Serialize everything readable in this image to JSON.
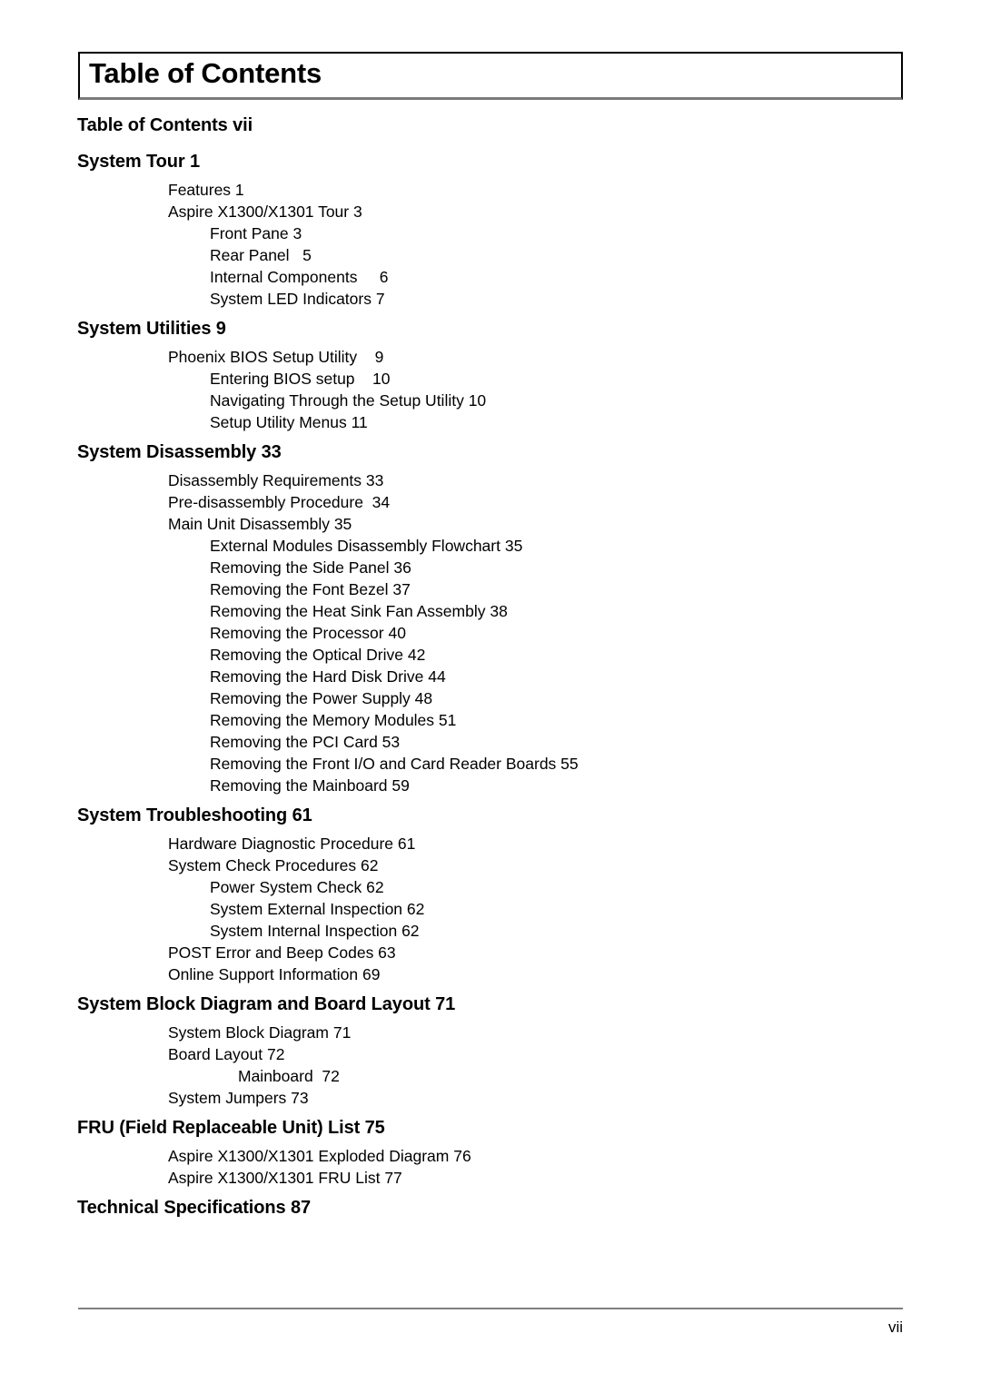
{
  "document": {
    "title": "Table of Contents",
    "page_number": "vii"
  },
  "toc": {
    "entries": [
      {
        "level": "h",
        "text": "Table of Contents vii"
      },
      {
        "level": "h",
        "text": "System Tour 1"
      },
      {
        "level": "1",
        "text": "Features 1"
      },
      {
        "level": "1",
        "text": "Aspire X1300/X1301 Tour 3"
      },
      {
        "level": "2",
        "text": "Front Pane 3"
      },
      {
        "level": "2",
        "text": "Rear Panel   5"
      },
      {
        "level": "2",
        "text": "Internal Components     6"
      },
      {
        "level": "2",
        "text": "System LED Indicators 7"
      },
      {
        "level": "h",
        "text": "System Utilities 9"
      },
      {
        "level": "1",
        "text": "Phoenix BIOS Setup Utility    9"
      },
      {
        "level": "2",
        "text": "Entering BIOS setup    10"
      },
      {
        "level": "2",
        "text": "Navigating Through the Setup Utility 10"
      },
      {
        "level": "2",
        "text": "Setup Utility Menus 11"
      },
      {
        "level": "h",
        "text": "System Disassembly 33"
      },
      {
        "level": "1",
        "text": "Disassembly Requirements 33"
      },
      {
        "level": "1",
        "text": "Pre-disassembly Procedure  34"
      },
      {
        "level": "1",
        "text": "Main Unit Disassembly 35"
      },
      {
        "level": "2",
        "text": "External Modules Disassembly Flowchart 35"
      },
      {
        "level": "2",
        "text": "Removing the Side Panel 36"
      },
      {
        "level": "2",
        "text": "Removing the Font Bezel 37"
      },
      {
        "level": "2",
        "text": "Removing the Heat Sink Fan Assembly 38"
      },
      {
        "level": "2",
        "text": "Removing the Processor 40"
      },
      {
        "level": "2",
        "text": "Removing the Optical Drive 42"
      },
      {
        "level": "2",
        "text": "Removing the Hard Disk Drive 44"
      },
      {
        "level": "2",
        "text": "Removing the Power Supply 48"
      },
      {
        "level": "2",
        "text": "Removing the Memory Modules 51"
      },
      {
        "level": "2",
        "text": "Removing the PCI Card 53"
      },
      {
        "level": "2",
        "text": "Removing the Front I/O and Card Reader Boards 55"
      },
      {
        "level": "2",
        "text": "Removing the Mainboard 59"
      },
      {
        "level": "h",
        "text": "System Troubleshooting 61"
      },
      {
        "level": "1",
        "text": "Hardware Diagnostic Procedure 61"
      },
      {
        "level": "1",
        "text": "System Check Procedures 62"
      },
      {
        "level": "2",
        "text": "Power System Check 62"
      },
      {
        "level": "2",
        "text": "System External Inspection 62"
      },
      {
        "level": "2",
        "text": "System Internal Inspection 62"
      },
      {
        "level": "1",
        "text": "POST Error and Beep Codes 63"
      },
      {
        "level": "1",
        "text": "Online Support Information 69"
      },
      {
        "level": "h",
        "text": "System Block Diagram and Board Layout 71"
      },
      {
        "level": "1",
        "text": "System Block Diagram 71"
      },
      {
        "level": "1",
        "text": "Board Layout 72"
      },
      {
        "level": "3",
        "text": "Mainboard  72"
      },
      {
        "level": "1",
        "text": "System Jumpers 73"
      },
      {
        "level": "h",
        "text": "FRU (Field Replaceable Unit) List 75"
      },
      {
        "level": "1",
        "text": "Aspire X1300/X1301 Exploded Diagram 76"
      },
      {
        "level": "1",
        "text": "Aspire X1300/X1301 FRU List 77"
      },
      {
        "level": "h",
        "text": "Technical Specifications 87"
      }
    ]
  }
}
